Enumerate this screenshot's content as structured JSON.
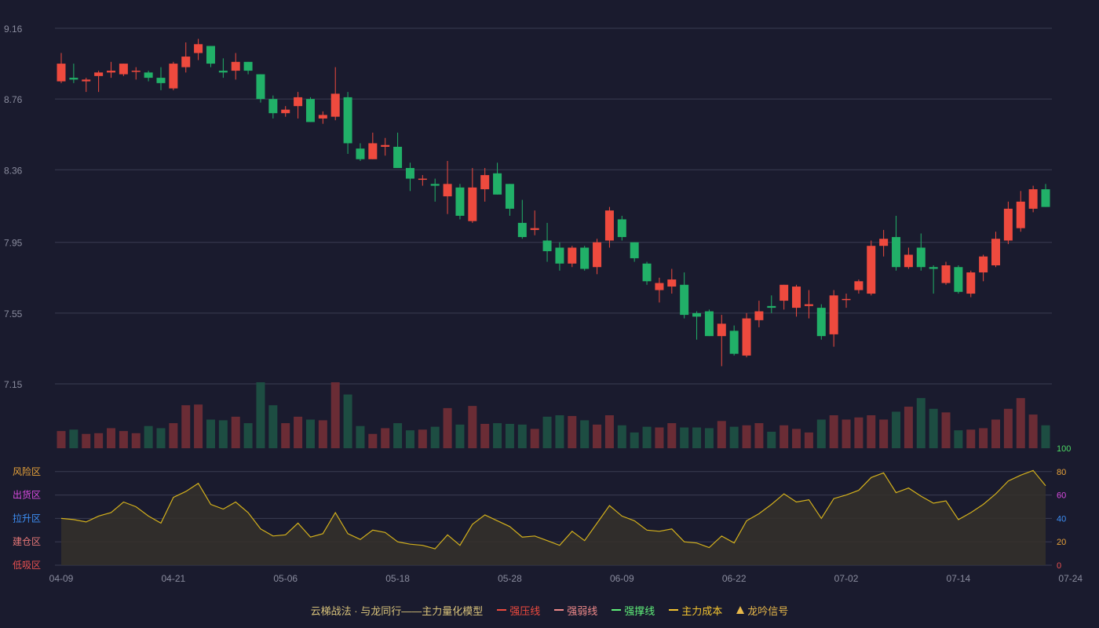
{
  "chart_data": {
    "type": "candlestick",
    "y_ticks": [
      "9.16",
      "8.76",
      "8.36",
      "7.95",
      "7.55",
      "7.15"
    ],
    "price_range": [
      7.15,
      9.16
    ],
    "x_ticks": [
      {
        "index": 0,
        "label": "04-09"
      },
      {
        "index": 9,
        "label": "04-21"
      },
      {
        "index": 18,
        "label": "05-06"
      },
      {
        "index": 27,
        "label": "05-18"
      },
      {
        "index": 36,
        "label": "05-28"
      },
      {
        "index": 45,
        "label": "06-09"
      },
      {
        "index": 54,
        "label": "06-22"
      },
      {
        "index": 63,
        "label": "07-02"
      },
      {
        "index": 72,
        "label": "07-14"
      },
      {
        "index": 81,
        "label": "07-24"
      }
    ],
    "candles": [
      [
        8.86,
        8.96,
        8.85,
        9.02
      ],
      [
        8.88,
        8.87,
        8.85,
        8.96
      ],
      [
        8.86,
        8.87,
        8.8,
        8.88
      ],
      [
        8.89,
        8.91,
        8.8,
        8.92
      ],
      [
        8.91,
        8.92,
        8.88,
        8.97
      ],
      [
        8.9,
        8.96,
        8.89,
        8.96
      ],
      [
        8.92,
        8.92,
        8.87,
        8.94
      ],
      [
        8.91,
        8.88,
        8.86,
        8.92
      ],
      [
        8.88,
        8.85,
        8.81,
        8.94
      ],
      [
        8.82,
        8.96,
        8.81,
        8.97
      ],
      [
        8.94,
        9.0,
        8.91,
        9.08
      ],
      [
        9.02,
        9.07,
        8.98,
        9.1
      ],
      [
        9.06,
        8.96,
        8.94,
        9.06
      ],
      [
        8.92,
        8.91,
        8.88,
        8.99
      ],
      [
        8.92,
        8.97,
        8.87,
        9.02
      ],
      [
        8.97,
        8.92,
        8.9,
        8.97
      ],
      [
        8.9,
        8.76,
        8.74,
        8.9
      ],
      [
        8.76,
        8.68,
        8.65,
        8.78
      ],
      [
        8.68,
        8.7,
        8.66,
        8.72
      ],
      [
        8.72,
        8.77,
        8.65,
        8.8
      ],
      [
        8.76,
        8.63,
        8.63,
        8.77
      ],
      [
        8.65,
        8.67,
        8.62,
        8.69
      ],
      [
        8.66,
        8.79,
        8.64,
        8.94
      ],
      [
        8.77,
        8.51,
        8.45,
        8.8
      ],
      [
        8.48,
        8.42,
        8.41,
        8.51
      ],
      [
        8.42,
        8.51,
        8.42,
        8.57
      ],
      [
        8.49,
        8.5,
        8.44,
        8.54
      ],
      [
        8.49,
        8.37,
        8.37,
        8.57
      ],
      [
        8.37,
        8.31,
        8.24,
        8.4
      ],
      [
        8.31,
        8.31,
        8.27,
        8.33
      ],
      [
        8.28,
        8.27,
        8.18,
        8.31
      ],
      [
        8.21,
        8.28,
        8.11,
        8.41
      ],
      [
        8.26,
        8.1,
        8.08,
        8.28
      ],
      [
        8.07,
        8.26,
        8.06,
        8.37
      ],
      [
        8.25,
        8.33,
        8.18,
        8.37
      ],
      [
        8.34,
        8.22,
        8.22,
        8.4
      ],
      [
        8.28,
        8.14,
        8.1,
        8.28
      ],
      [
        8.06,
        7.98,
        7.97,
        8.19
      ],
      [
        8.02,
        8.03,
        7.99,
        8.13
      ],
      [
        7.96,
        7.9,
        7.84,
        8.06
      ],
      [
        7.92,
        7.83,
        7.79,
        7.95
      ],
      [
        7.83,
        7.92,
        7.81,
        7.93
      ],
      [
        7.92,
        7.8,
        7.79,
        7.93
      ],
      [
        7.81,
        7.95,
        7.77,
        7.97
      ],
      [
        7.96,
        8.13,
        7.92,
        8.15
      ],
      [
        8.08,
        7.98,
        7.96,
        8.1
      ],
      [
        7.95,
        7.86,
        7.84,
        7.95
      ],
      [
        7.83,
        7.73,
        7.71,
        7.84
      ],
      [
        7.68,
        7.72,
        7.61,
        7.75
      ],
      [
        7.7,
        7.74,
        7.66,
        7.8
      ],
      [
        7.71,
        7.54,
        7.52,
        7.78
      ],
      [
        7.55,
        7.53,
        7.4,
        7.56
      ],
      [
        7.56,
        7.42,
        7.42,
        7.57
      ],
      [
        7.42,
        7.49,
        7.25,
        7.54
      ],
      [
        7.45,
        7.32,
        7.31,
        7.48
      ],
      [
        7.31,
        7.52,
        7.3,
        7.55
      ],
      [
        7.51,
        7.56,
        7.47,
        7.62
      ],
      [
        7.59,
        7.58,
        7.55,
        7.65
      ],
      [
        7.62,
        7.71,
        7.57,
        7.71
      ],
      [
        7.58,
        7.7,
        7.53,
        7.71
      ],
      [
        7.59,
        7.6,
        7.52,
        7.68
      ],
      [
        7.58,
        7.42,
        7.4,
        7.6
      ],
      [
        7.43,
        7.65,
        7.36,
        7.68
      ],
      [
        7.63,
        7.63,
        7.58,
        7.66
      ],
      [
        7.68,
        7.73,
        7.66,
        7.74
      ],
      [
        7.66,
        7.93,
        7.65,
        7.96
      ],
      [
        7.93,
        7.97,
        7.87,
        8.02
      ],
      [
        7.98,
        7.81,
        7.79,
        8.1
      ],
      [
        7.81,
        7.88,
        7.8,
        7.92
      ],
      [
        7.92,
        7.81,
        7.79,
        8.0
      ],
      [
        7.81,
        7.8,
        7.66,
        7.82
      ],
      [
        7.72,
        7.82,
        7.71,
        7.84
      ],
      [
        7.81,
        7.67,
        7.66,
        7.82
      ],
      [
        7.66,
        7.78,
        7.64,
        7.79
      ],
      [
        7.78,
        7.87,
        7.73,
        7.88
      ],
      [
        7.82,
        7.97,
        7.81,
        8.01
      ],
      [
        7.96,
        8.14,
        7.94,
        8.18
      ],
      [
        8.03,
        8.18,
        8.01,
        8.24
      ],
      [
        8.14,
        8.25,
        8.12,
        8.27
      ],
      [
        8.25,
        8.15,
        8.15,
        8.28
      ]
    ],
    "candle_colors": {
      "up": "#ee4a3e",
      "down": "#21b068"
    },
    "volume": [
      24,
      26,
      20,
      21,
      28,
      24,
      21,
      31,
      28,
      35,
      60,
      61,
      40,
      39,
      44,
      35,
      92,
      60,
      35,
      44,
      40,
      39,
      92,
      75,
      31,
      20,
      28,
      35,
      25,
      26,
      30,
      56,
      33,
      59,
      34,
      35,
      34,
      33,
      27,
      44,
      46,
      45,
      39,
      33,
      46,
      32,
      22,
      30,
      29,
      35,
      29,
      29,
      28,
      38,
      30,
      32,
      35,
      23,
      32,
      27,
      22,
      40,
      46,
      40,
      43,
      46,
      40,
      51,
      58,
      70,
      55,
      50,
      25,
      26,
      28,
      40,
      55,
      70,
      47,
      32,
      30
    ],
    "volume_colors": {
      "up": "#6a2c35",
      "down": "#1d4d42"
    },
    "indicator": [
      40,
      39,
      37,
      42,
      45,
      54,
      50,
      42,
      36,
      58,
      63,
      70,
      52,
      48,
      54,
      45,
      31,
      25,
      26,
      36,
      24,
      27,
      45,
      27,
      22,
      30,
      28,
      20,
      18,
      17,
      14,
      26,
      17,
      35,
      43,
      38,
      33,
      24,
      25,
      21,
      17,
      29,
      21,
      36,
      51,
      42,
      38,
      30,
      29,
      31,
      20,
      19,
      15,
      25,
      19,
      38,
      44,
      52,
      61,
      54,
      56,
      40,
      57,
      60,
      64,
      75,
      79,
      62,
      66,
      59,
      53,
      55,
      39,
      45,
      52,
      61,
      72,
      77,
      81,
      68
    ],
    "indicator_ticks": [
      {
        "value": 100,
        "label": "100",
        "color": "#4cd964"
      },
      {
        "value": 80,
        "label": "80",
        "color": "#e8a33a"
      },
      {
        "value": 60,
        "label": "60",
        "color": "#d94be0"
      },
      {
        "value": 40,
        "label": "40",
        "color": "#3d8ff5"
      },
      {
        "value": 20,
        "label": "20",
        "color": "#e8a33a"
      },
      {
        "value": 0,
        "label": "0",
        "color": "#e85050"
      }
    ],
    "zone_labels": [
      {
        "value": 80,
        "label": "风险区",
        "color": "#e8a33a"
      },
      {
        "value": 60,
        "label": "出货区",
        "color": "#d94be0"
      },
      {
        "value": 40,
        "label": "拉升区",
        "color": "#3d8ff5"
      },
      {
        "value": 20,
        "label": "建仓区",
        "color": "#e87878"
      },
      {
        "value": 0,
        "label": "低吸区",
        "color": "#e85050"
      }
    ],
    "indicator_line_color": "#d4b11c",
    "indicator_fill_color": "#35302a"
  },
  "legend": {
    "title": "云梯战法 · 与龙同行——主力量化模型",
    "items": [
      {
        "label": "强压线",
        "color": "#ee4a3e",
        "style": "solid"
      },
      {
        "label": "强弱线",
        "color": "#f08a8a",
        "style": "dashed"
      },
      {
        "label": "强撑线",
        "color": "#5ff07a",
        "style": "solid"
      },
      {
        "label": "主力成本",
        "color": "#f4c430",
        "style": "dashed"
      },
      {
        "label": "龙吟信号",
        "color": "#e8b84a",
        "style": "triangle"
      }
    ]
  }
}
